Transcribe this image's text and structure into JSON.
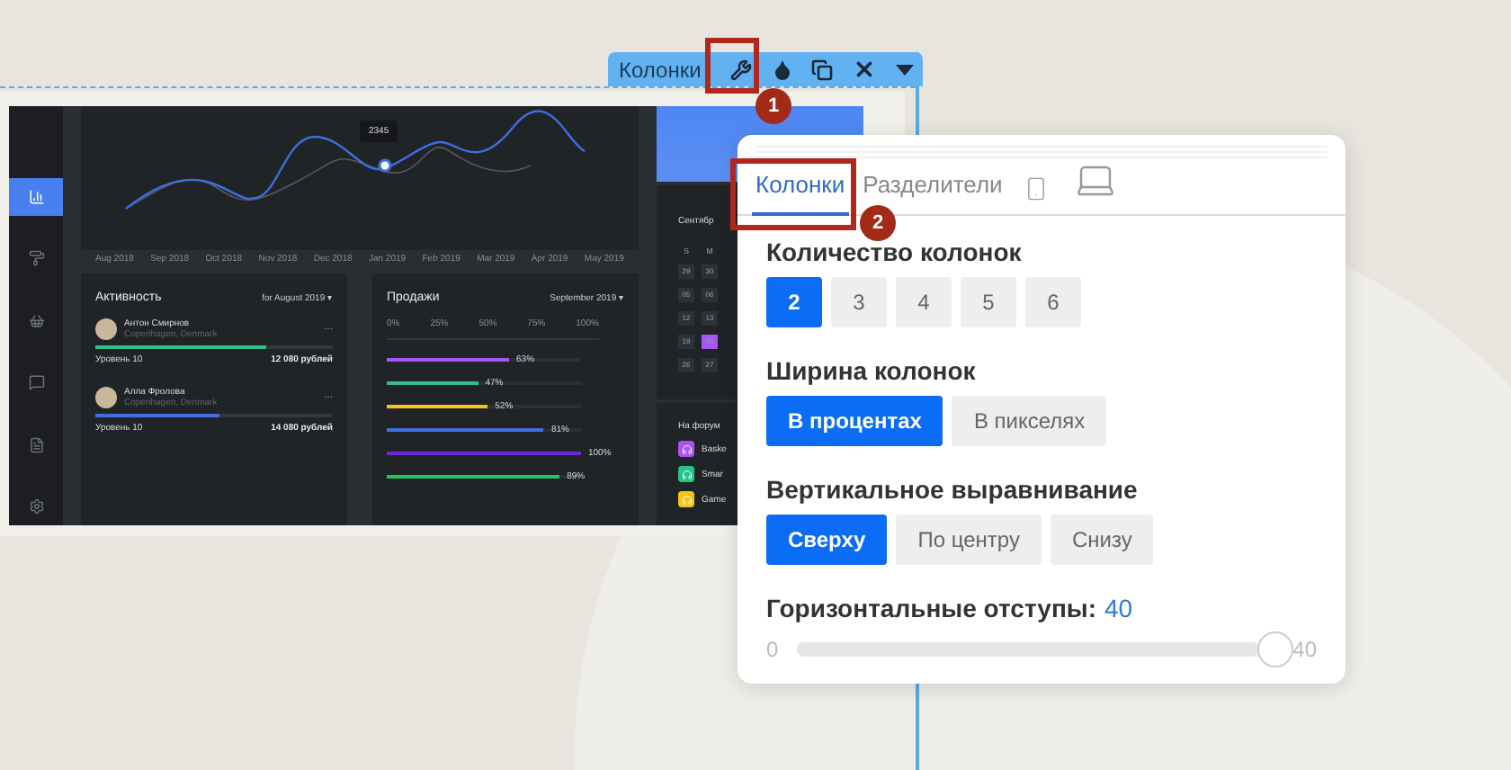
{
  "toolbar": {
    "label": "Колонки"
  },
  "callouts": [
    {
      "number": "1"
    },
    {
      "number": "2"
    }
  ],
  "dashboard": {
    "chart": {
      "tooltip": "2345",
      "months": [
        "Aug 2018",
        "Sep 2018",
        "Oct 2018",
        "Nov 2018",
        "Dec 2018",
        "Jan 2019",
        "Feb 2019",
        "Mar 2019",
        "Apr 2019",
        "May 2019"
      ]
    },
    "activity": {
      "title": "Активность",
      "period": "for August 2019 ▾",
      "people": [
        {
          "name": "Антон Смирнов",
          "place": "Copenhagen, Denmark",
          "level": 0.72,
          "color": "#2fc08a",
          "rank": "Уровень 10",
          "amount": "12 080 рублей",
          "menu": "···"
        },
        {
          "name": "Алла Фролова",
          "place": "Copenhagen, Denmark",
          "level": 0.52,
          "color": "#3f6fe0",
          "rank": "Уровень 10",
          "amount": "14 080 рублей",
          "menu": "···"
        }
      ]
    },
    "sales": {
      "title": "Продажи",
      "period": "September 2019 ▾",
      "scale": [
        "0%",
        "25%",
        "50%",
        "75%",
        "100%"
      ],
      "bars": [
        {
          "label": "63%",
          "level": 0.63,
          "color": "#a855f7"
        },
        {
          "label": "47%",
          "level": 0.47,
          "color": "#2fc08a"
        },
        {
          "label": "52%",
          "level": 0.52,
          "color": "#f5c518"
        },
        {
          "label": "81%",
          "level": 0.81,
          "color": "#3f6fe0"
        },
        {
          "label": "100%",
          "level": 1,
          "color": "#6d28d9"
        },
        {
          "label": "89%",
          "level": 0.89,
          "color": "#22c55e"
        }
      ]
    },
    "calendar": {
      "title": "Сентябр",
      "weekdays": [
        "S",
        "M"
      ],
      "days": [
        {
          "label": "29",
          "selected": false
        },
        {
          "label": "30",
          "selected": false
        },
        {
          "label": "05",
          "selected": false
        },
        {
          "label": "06",
          "selected": false
        },
        {
          "label": "12",
          "selected": false
        },
        {
          "label": "13",
          "selected": false
        },
        {
          "label": "19",
          "selected": false
        },
        {
          "label": "20",
          "selected": true
        },
        {
          "label": "26",
          "selected": false
        },
        {
          "label": "27",
          "selected": false
        }
      ]
    },
    "forum": {
      "title": "На форум",
      "items": [
        {
          "name": "Baske",
          "color": "#a855f7"
        },
        {
          "name": "Smar",
          "color": "#22c58b"
        },
        {
          "name": "Game",
          "color": "#f5c518"
        }
      ]
    }
  },
  "popup": {
    "tabs": [
      {
        "label": "Колонки",
        "selected": true
      },
      {
        "label": "Разделители",
        "selected": false
      }
    ],
    "device_tabs": [
      {
        "kind": "phone"
      },
      {
        "kind": "laptop"
      }
    ],
    "sections": [
      {
        "title": "Количество колонок",
        "options": [
          {
            "label": "2",
            "selected": true
          },
          {
            "label": "3",
            "selected": false
          },
          {
            "label": "4",
            "selected": false
          },
          {
            "label": "5",
            "selected": false
          },
          {
            "label": "6",
            "selected": false
          }
        ]
      },
      {
        "title": "Ширина колонок",
        "options": [
          {
            "label": "В процентах",
            "selected": true
          },
          {
            "label": "В пикселях",
            "selected": false
          }
        ]
      },
      {
        "title": "Вертикальное выравнивание",
        "options": [
          {
            "label": "Сверху",
            "selected": true
          },
          {
            "label": "По центру",
            "selected": false
          },
          {
            "label": "Снизу",
            "selected": false
          }
        ]
      }
    ],
    "slider": {
      "label": "Горизонтальные отступы:",
      "value": "40",
      "min": "0",
      "max": "40",
      "level": 1
    }
  }
}
